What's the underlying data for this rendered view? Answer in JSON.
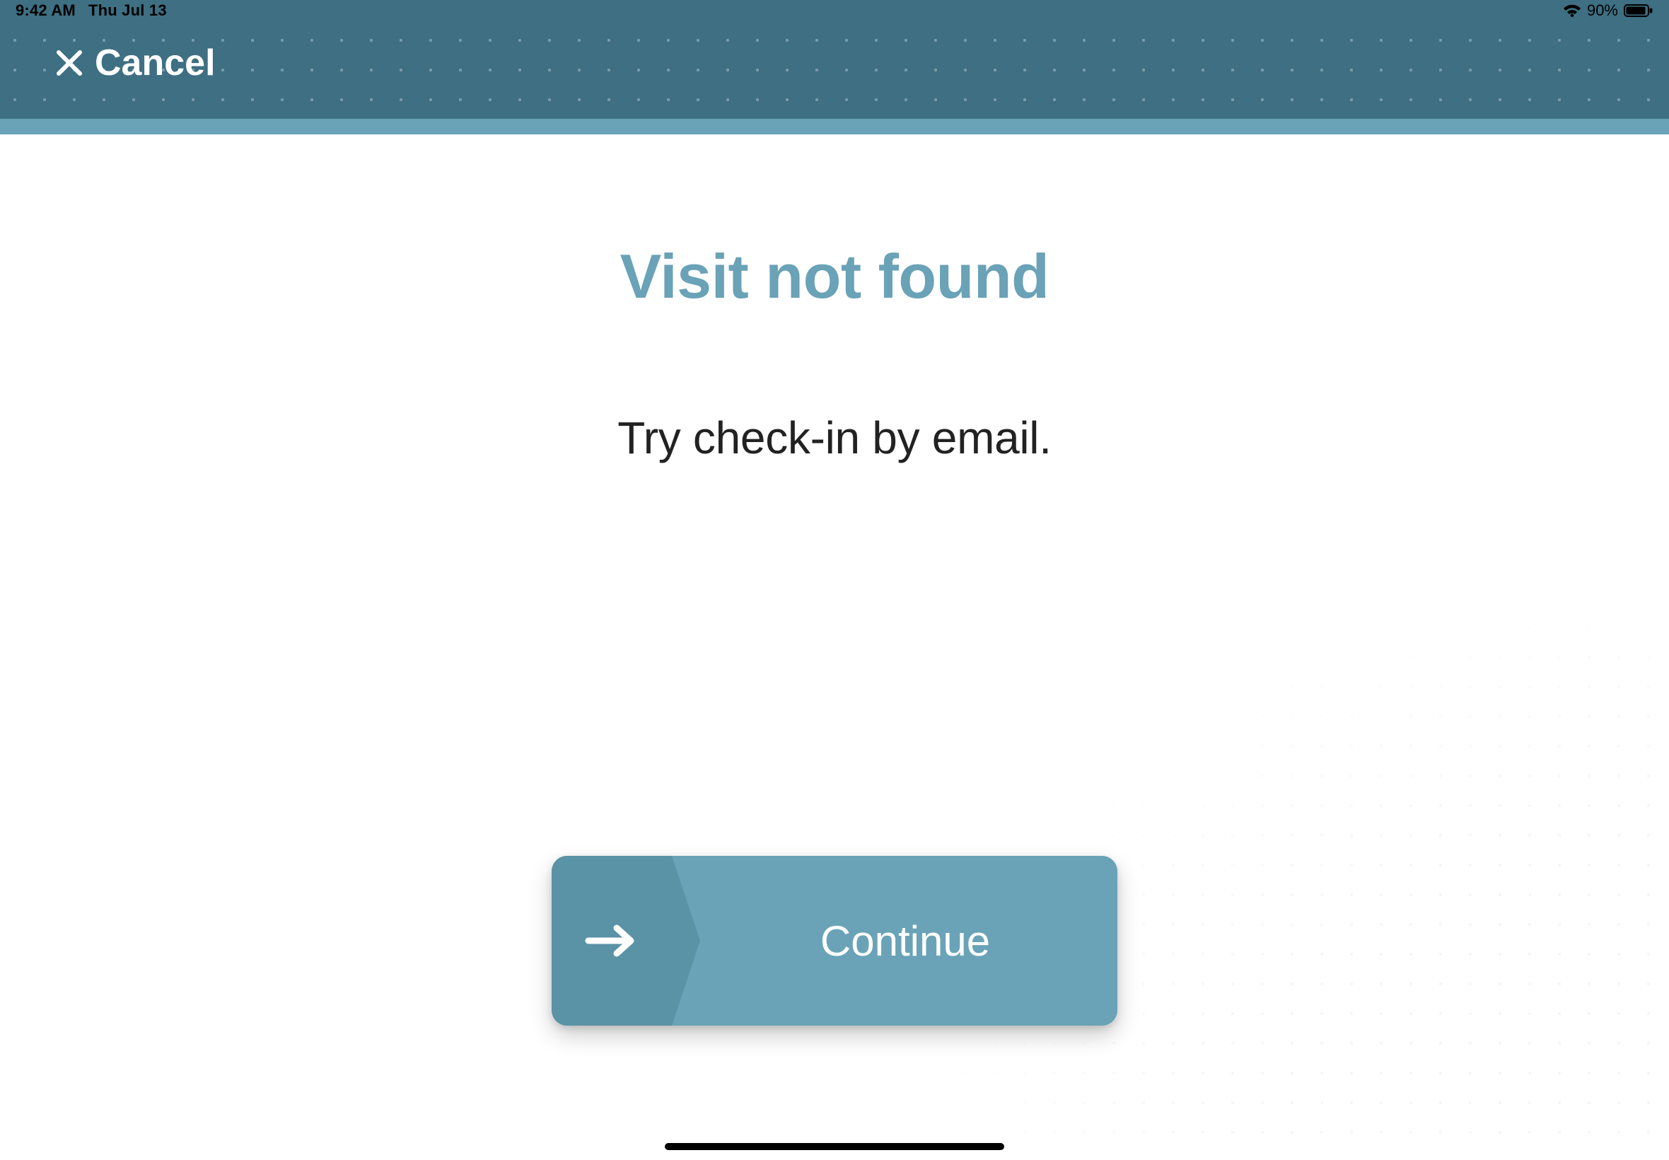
{
  "status": {
    "time": "9:42 AM",
    "date": "Thu Jul 13",
    "battery_pct": "90%"
  },
  "header": {
    "cancel_label": "Cancel"
  },
  "main": {
    "title": "Visit not found",
    "subtitle": "Try check-in by email."
  },
  "action": {
    "continue_label": "Continue"
  }
}
